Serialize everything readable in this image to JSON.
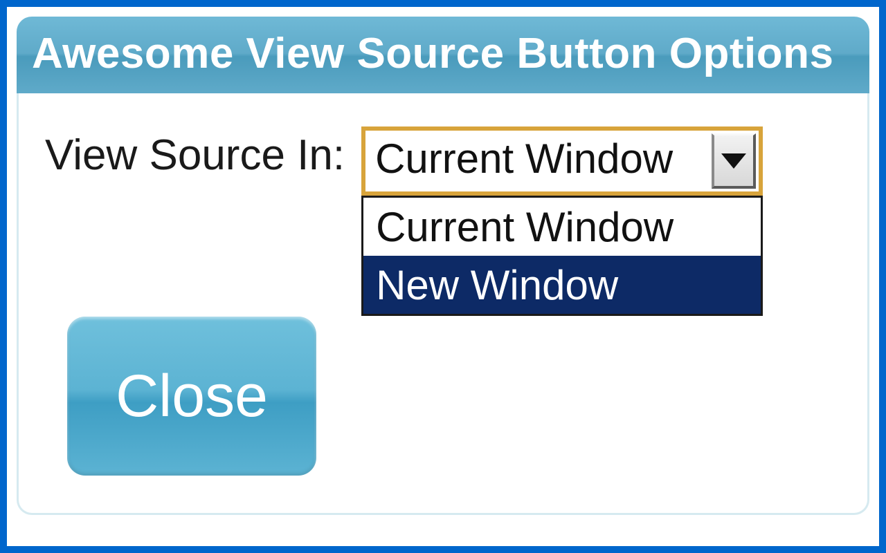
{
  "dialog": {
    "title": "Awesome View Source Button Options",
    "label": "View Source In:",
    "select": {
      "value": "Current Window",
      "options": [
        "Current Window",
        "New Window"
      ],
      "highlighted_index": 1
    },
    "close_label": "Close"
  }
}
